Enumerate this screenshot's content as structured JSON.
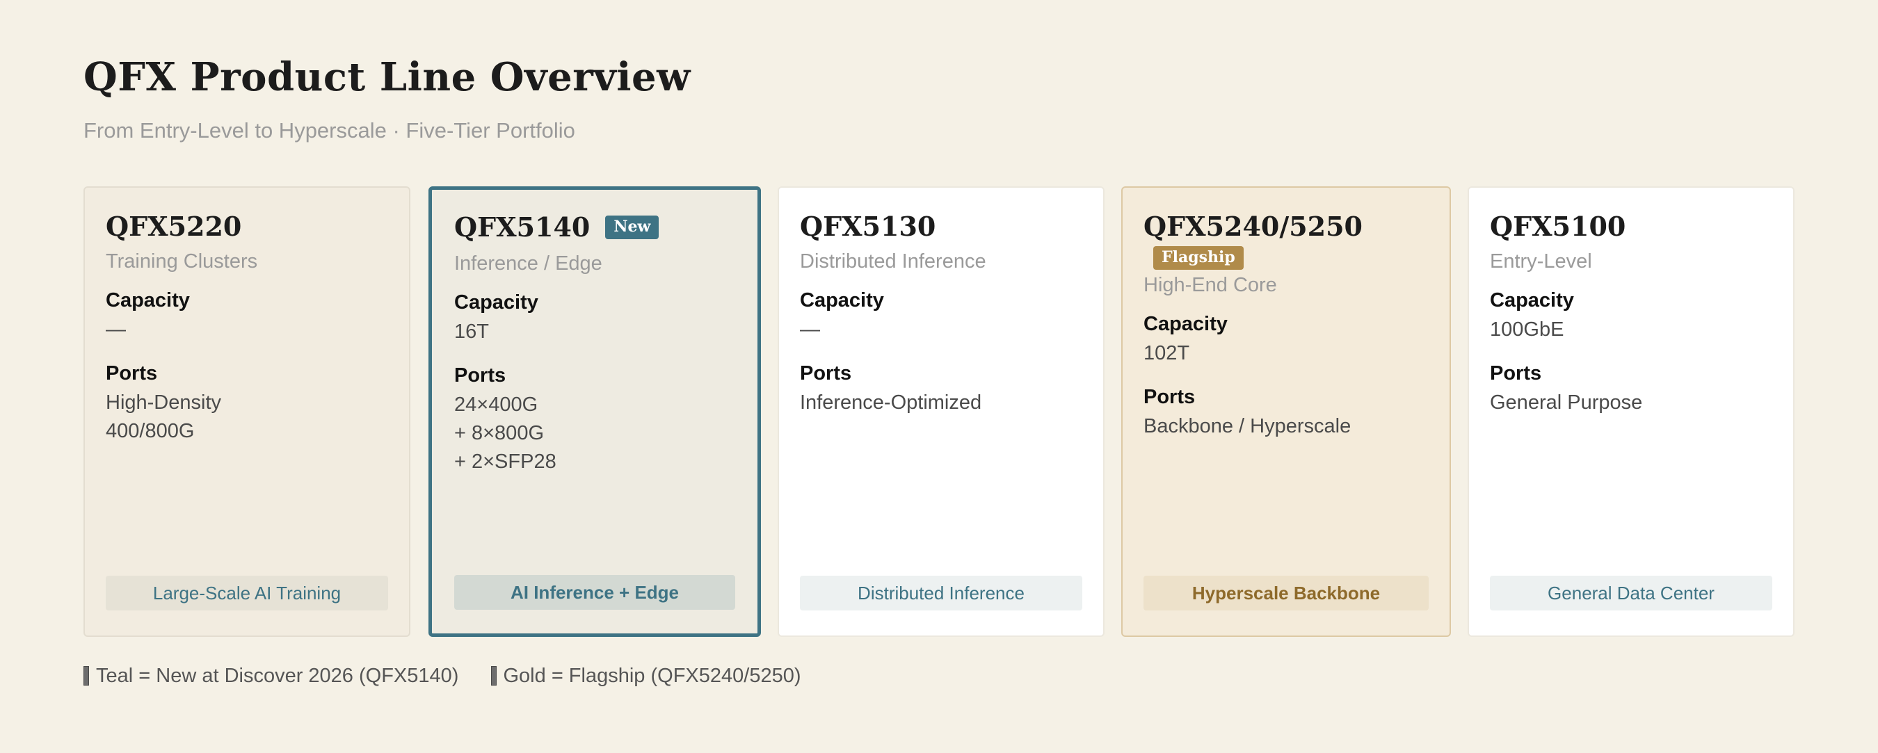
{
  "header": {
    "title": "QFX Product Line Overview",
    "subtitle": "From Entry-Level to Hyperscale · Five-Tier Portfolio"
  },
  "spec_labels": {
    "capacity": "Capacity",
    "ports": "Ports"
  },
  "cards": [
    {
      "name": "QFX5220",
      "badge": "",
      "role": "Training Clusters",
      "capacity": "—",
      "ports": "High-Density\n400/800G",
      "tag": "Large-Scale AI Training"
    },
    {
      "name": "QFX5140",
      "badge": "New",
      "role": "Inference / Edge",
      "capacity": "16T",
      "ports": "24×400G\n+ 8×800G\n+ 2×SFP28",
      "tag": "AI Inference + Edge"
    },
    {
      "name": "QFX5130",
      "badge": "",
      "role": "Distributed Inference",
      "capacity": "—",
      "ports": "Inference-Optimized",
      "tag": "Distributed Inference"
    },
    {
      "name": "QFX5240/5250",
      "badge": "Flagship",
      "role": "High-End Core",
      "capacity": "102T",
      "ports": "Backbone / Hyperscale",
      "tag": "Hyperscale Backbone"
    },
    {
      "name": "QFX5100",
      "badge": "",
      "role": "Entry-Level",
      "capacity": "100GbE",
      "ports": "General Purpose",
      "tag": "General Data Center"
    }
  ],
  "legend": {
    "teal": "Teal = New at Discover 2026 (QFX5140)",
    "gold": "Gold = Flagship (QFX5240/5250)"
  },
  "colors": {
    "background": "#f5f1e6",
    "teal_accent": "#3e7384",
    "gold_accent": "#b08b4a"
  }
}
